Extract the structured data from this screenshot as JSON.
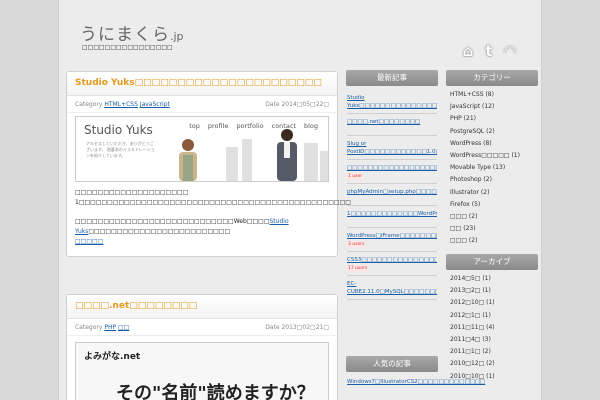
{
  "header": {
    "title_main": "うにまくら",
    "title_tld": ".jp",
    "tagline": "□□□□□□□□□□□□□□□□",
    "icons": [
      {
        "name": "home-icon",
        "glyph": "⌂"
      },
      {
        "name": "twitter-icon",
        "glyph": "t"
      },
      {
        "name": "rss-icon",
        "glyph": "◠"
      }
    ]
  },
  "posts": [
    {
      "title": "Studio Yuks□□□□□□□□□□□□□□□□□□□□□□",
      "category_label": "Category",
      "categories": [
        "HTML+CSS",
        "JavaScript"
      ],
      "date_label": "Date",
      "date": "2014□05□22□",
      "image": {
        "logo": "Studio Yuks",
        "nav": [
          "top",
          "profile",
          "portfolio",
          "contact",
          "blog"
        ],
        "desc": "アキセスしていただき、ありがとうございます。 囲碁系のイラストレーションを紹介しています。"
      },
      "body_line1": "□□□□□□□□□□□□□□□□□□□□",
      "body_line2": "1□□□□□□□□□□□□□□□□□□□□□□□□□□□□□□□□□□□□□□□□□□□□□□□□",
      "body_line3_pre": "□□□□□□□□□□□□□□□□□□□□□□□□□□□□Web□□□□",
      "body_link": "Studio Yuks",
      "body_line3_post": "□□□□□□□□□□□□□□□□□□□□□□□□□",
      "more": "□□□□□"
    },
    {
      "title": "□□□□.net□□□□□□□□",
      "category_label": "Category",
      "categories": [
        "PHP",
        "□□"
      ],
      "date_label": "Date",
      "date": "2013□02□21□",
      "image": {
        "logo": "よみがな.net",
        "headline": "その\"名前\"読めますか？"
      }
    }
  ],
  "recent": {
    "heading": "最新記事",
    "items": [
      {
        "text": "Studio Yuks□□□□□□□□□□□□□□□□□□□□",
        "users": ""
      },
      {
        "text": "□□□□.net□□□□□□□□",
        "users": ""
      },
      {
        "text": "Slug or PostID□□□□□□□□□□□□1.0□□□□□□□□",
        "users": ""
      },
      {
        "text": "□□□□□□□□□□□□□□□□□□□□□□□□p",
        "users": "1 user"
      },
      {
        "text": "phpMyAdmin□setup.php□□□□□□□□□□□□□",
        "users": ""
      },
      {
        "text": "1□□□□□□□□□□□□□WordPress□□□□□□□□□□□□",
        "users": ""
      },
      {
        "text": "WordPress□iFrame□□□□□□□□□□□□□□□□□□□□□",
        "users": "3 users"
      },
      {
        "text": "CSS3□□□□□□□□□□□□□□□□□□□",
        "users": "17 users"
      },
      {
        "text": "EC-CUBE2.11.0□MySQL□□□□□□□□□□□□□□□□□",
        "users": ""
      }
    ]
  },
  "popular": {
    "heading": "人気の記事",
    "items": [
      {
        "text": "Windows7□IllustratorCS2□□□□□□□□□□□□□"
      }
    ]
  },
  "categories": {
    "heading": "カテゴリー",
    "items": [
      "HTML+CSS (8)",
      "JavaScript (12)",
      "PHP (21)",
      "PostgreSQL (2)",
      "WordPress (8)",
      "WordPress□□□□□ (1)",
      "Movable Type (13)",
      "Photoshop (2)",
      "Illustrator (2)",
      "Firefox (5)",
      "□□□ (2)",
      "□□ (23)",
      "□□□ (2)"
    ]
  },
  "archive": {
    "heading": "アーカイブ",
    "items": [
      "2014□5□ (1)",
      "2013□2□ (1)",
      "2012□10□ (1)",
      "2012□1□ (1)",
      "2011□11□ (4)",
      "2011□4□ (3)",
      "2011□1□ (2)",
      "2010□12□ (2)",
      "2010□10□ (1)"
    ]
  }
}
